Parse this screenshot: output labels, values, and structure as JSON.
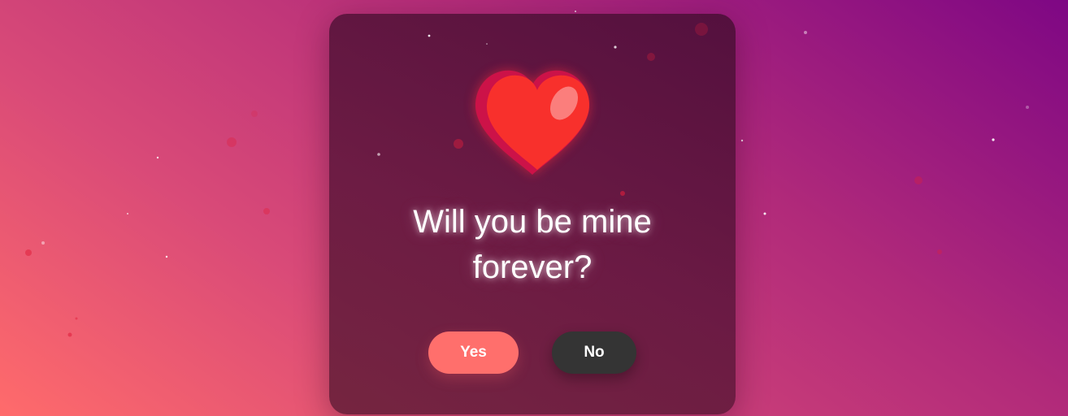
{
  "proposal": {
    "question": "Will you be mine forever?",
    "heart_icon": "heart-icon",
    "yes_label": "Yes",
    "no_label": "No"
  },
  "colors": {
    "background_start": "#ff6b6b",
    "background_end": "#7e0784",
    "card": "#581438",
    "heart": "#f8302c",
    "yes_button": "#ff6f6c",
    "no_button": "#343434",
    "text": "#ffffff"
  }
}
